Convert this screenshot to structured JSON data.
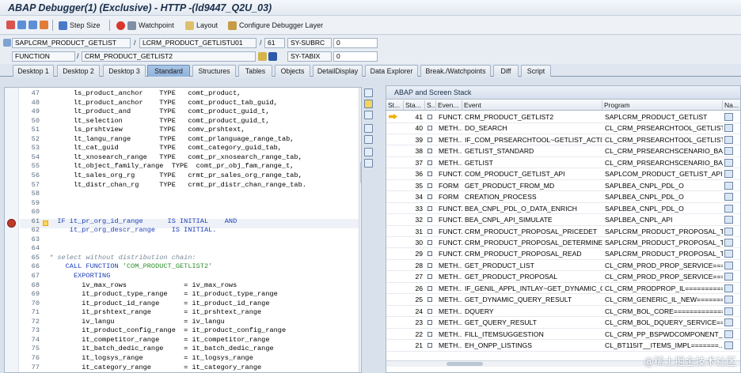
{
  "window": {
    "title": "ABAP Debugger(1)  (Exclusive) - HTTP -(ld9447_Q2U_03)"
  },
  "toolbar": {
    "step_size": "Step Size",
    "watchpoint": "Watchpoint",
    "layout": "Layout",
    "configure": "Configure Debugger Layer"
  },
  "fields": {
    "program": "SAPLCRM_PRODUCT_GETLIST",
    "include": "LCRM_PRODUCT_GETLISTU01",
    "line": "61",
    "subrc_label": "SY-SUBRC",
    "subrc_value": "0",
    "type": "FUNCTION",
    "func_name": "CRM_PRODUCT_GETLIST2",
    "tabix_label": "SY-TABIX",
    "tabix_value": "0"
  },
  "tabs": [
    "Desktop 1",
    "Desktop 2",
    "Desktop 3",
    "Standard",
    "Structures",
    "Tables",
    "Objects",
    "DetailDisplay",
    "Data Explorer",
    "Break./Watchpoints",
    "Diff",
    "Script"
  ],
  "active_tab": "Standard",
  "code": [
    {
      "n": "47",
      "t": "      ls_product_anchor    TYPE   comt_product,"
    },
    {
      "n": "48",
      "t": "      lt_product_anchor    TYPE   comt_product_tab_guid,"
    },
    {
      "n": "49",
      "t": "      lt_product_and       TYPE   comt_product_guid_t,"
    },
    {
      "n": "50",
      "t": "      lt_selection         TYPE   comt_product_guid_t,"
    },
    {
      "n": "51",
      "t": "      ls_prshtview         TYPE   comv_prshtext,"
    },
    {
      "n": "52",
      "t": "      lt_langu_range       TYPE   comt_prlanguage_range_tab,"
    },
    {
      "n": "53",
      "t": "      lt_cat_guid          TYPE   comt_category_guid_tab,"
    },
    {
      "n": "54",
      "t": "      lt_xnosearch_range   TYPE   comt_pr_xnosearch_range_tab,"
    },
    {
      "n": "55",
      "t": "      lt_object_family_range  TYPE  comt_pr_obj_fam_range_t,"
    },
    {
      "n": "56",
      "t": "      lt_sales_org_rg      TYPE   crmt_pr_sales_org_range_tab,"
    },
    {
      "n": "57",
      "t": "      lt_distr_chan_rg     TYPE   crmt_pr_distr_chan_range_tab."
    },
    {
      "n": "58",
      "t": ""
    },
    {
      "n": "59",
      "t": ""
    },
    {
      "n": "60",
      "t": ""
    },
    {
      "n": "61",
      "t": "  IF it_pr_org_id_range      IS INITIAL    AND"
    },
    {
      "n": "62",
      "t": "     it_pr_org_descr_range    IS INITIAL."
    },
    {
      "n": "63",
      "t": ""
    },
    {
      "n": "64",
      "t": ""
    },
    {
      "n": "65",
      "t": "* select without distribution chain:"
    },
    {
      "n": "66",
      "t": "    CALL FUNCTION 'COM_PRODUCT_GETLIST2'"
    },
    {
      "n": "67",
      "t": "      EXPORTING"
    },
    {
      "n": "68",
      "t": "        iv_max_rows              = iv_max_rows"
    },
    {
      "n": "69",
      "t": "        it_product_type_range    = it_product_type_range"
    },
    {
      "n": "70",
      "t": "        it_product_id_range      = it_product_id_range"
    },
    {
      "n": "71",
      "t": "        it_prshtext_range        = it_prshtext_range"
    },
    {
      "n": "72",
      "t": "        iv_langu                 = iv_langu"
    },
    {
      "n": "73",
      "t": "        it_product_config_range  = it_product_config_range"
    },
    {
      "n": "74",
      "t": "        it_competitor_range      = it_competitor_range"
    },
    {
      "n": "75",
      "t": "        it_batch_dedic_range     = it_batch_dedic_range"
    },
    {
      "n": "76",
      "t": "        it_logsys_range          = it_logsys_range"
    },
    {
      "n": "77",
      "t": "        it_category_range        = it_category_range"
    }
  ],
  "stack": {
    "title": "ABAP and Screen Stack",
    "columns": [
      "St...",
      "Sta...",
      "S...",
      "Even...",
      "Event",
      "Program",
      "Na..."
    ],
    "rows": [
      {
        "level": "41",
        "type": "FUNCT...",
        "event": "CRM_PRODUCT_GETLIST2",
        "program": "SAPLCRM_PRODUCT_GETLIST",
        "current": true
      },
      {
        "level": "40",
        "type": "METH...",
        "event": "DO_SEARCH",
        "program": "CL_CRM_PRSEARCHTOOL_GETLIST==..."
      },
      {
        "level": "39",
        "type": "METH...",
        "event": "IF_COM_PRSEARCHTOOL~GETLIST_ACTIVE",
        "program": "CL_CRM_PRSEARCHTOOL_GETLIST==..."
      },
      {
        "level": "38",
        "type": "METH...",
        "event": "GETLIST_STANDARD",
        "program": "CL_CRM_PRSEARCHSCENARIO_BASE=..."
      },
      {
        "level": "37",
        "type": "METH...",
        "event": "GETLIST",
        "program": "CL_CRM_PRSEARCHSCENARIO_BASE=..."
      },
      {
        "level": "36",
        "type": "FUNCT...",
        "event": "COM_PRODUCT_GETLIST_API",
        "program": "SAPLCOM_PRODUCT_GETLIST_API"
      },
      {
        "level": "35",
        "type": "FORM",
        "event": "GET_PRODUCT_FROM_MD",
        "program": "SAPLBEA_CNPL_PDL_O"
      },
      {
        "level": "34",
        "type": "FORM",
        "event": "CREATION_PROCESS",
        "program": "SAPLBEA_CNPL_PDL_O"
      },
      {
        "level": "33",
        "type": "FUNCT...",
        "event": "BEA_CNPL_PDL_O_DATA_ENRICH",
        "program": "SAPLBEA_CNPL_PDL_O"
      },
      {
        "level": "32",
        "type": "FUNCT...",
        "event": "BEA_CNPL_API_SIMULATE",
        "program": "SAPLBEA_CNPL_API"
      },
      {
        "level": "31",
        "type": "FUNCT...",
        "event": "CRM_PRODUCT_PROPOSAL_PRICEDET",
        "program": "SAPLCRM_PRODUCT_PROPOSAL_TOO..."
      },
      {
        "level": "30",
        "type": "FUNCT...",
        "event": "CRM_PRODUCT_PROPOSAL_DETERMINE",
        "program": "SAPLCRM_PRODUCT_PROPOSAL_TOO..."
      },
      {
        "level": "29",
        "type": "FUNCT...",
        "event": "CRM_PRODUCT_PROPOSAL_READ",
        "program": "SAPLCRM_PRODUCT_PROPOSAL_TOO..."
      },
      {
        "level": "28",
        "type": "METH...",
        "event": "GET_PRODUCT_LIST",
        "program": "CL_CRM_PROD_PROP_SERVICE====..."
      },
      {
        "level": "27",
        "type": "METH...",
        "event": "GET_PRODUCT_PROPOSAL",
        "program": "CL_CRM_PROD_PROP_SERVICE====..."
      },
      {
        "level": "26",
        "type": "METH...",
        "event": "IF_GENIL_APPL_INTLAY~GET_DYNAMIC_QU...",
        "program": "CL_CRM_PRODPROP_IL==========..."
      },
      {
        "level": "25",
        "type": "METH...",
        "event": "GET_DYNAMIC_QUERY_RESULT",
        "program": "CL_CRM_GENERIC_IL_NEW=======..."
      },
      {
        "level": "24",
        "type": "METH...",
        "event": "DQUERY",
        "program": "CL_CRM_BOL_CORE==============..."
      },
      {
        "level": "23",
        "type": "METH...",
        "event": "GET_QUERY_RESULT",
        "program": "CL_CRM_BOL_DQUERY_SERVICE===..."
      },
      {
        "level": "22",
        "type": "METH...",
        "event": "FILL_ITEMSUGGESTION",
        "program": "CL_CRM_PP_BSPWDCOMPONENT_CN0..."
      },
      {
        "level": "21",
        "type": "METH...",
        "event": "EH_ONPP_LISTINGS",
        "program": "CL_BT115IT__ITEMS_IMPL=======..."
      }
    ]
  },
  "watermark": "@稀土掘金技术社区",
  "colors": {
    "accent": "#8fb2dc",
    "keyword": "#1f3fb5",
    "string": "#2f8f2f",
    "breakpoint": "#c0392b"
  }
}
